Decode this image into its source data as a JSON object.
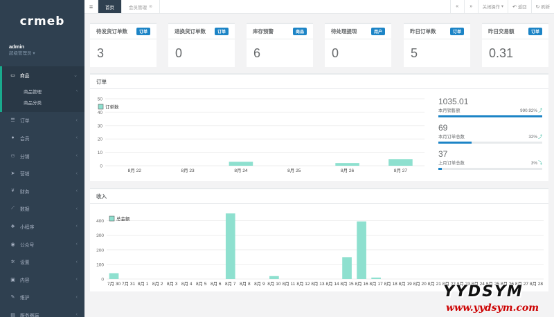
{
  "app": {
    "logo_text": "crmeb"
  },
  "profile": {
    "name": "admin",
    "role": "超级管理员"
  },
  "sidebar": {
    "items": [
      {
        "icon": "monitor-icon",
        "label": "商品",
        "active": true,
        "children": [
          {
            "label": "商品管理"
          },
          {
            "label": "商品分类"
          }
        ]
      },
      {
        "icon": "list-icon",
        "label": "订单"
      },
      {
        "icon": "user-icon",
        "label": "会员"
      },
      {
        "icon": "users-icon",
        "label": "分销"
      },
      {
        "icon": "send-icon",
        "label": "营销"
      },
      {
        "icon": "money-icon",
        "label": "财务"
      },
      {
        "icon": "chart-icon",
        "label": "数据"
      },
      {
        "icon": "cubes-icon",
        "label": "小程序"
      },
      {
        "icon": "wechat-icon",
        "label": "公众号"
      },
      {
        "icon": "gear-icon",
        "label": "设置"
      },
      {
        "icon": "box-icon",
        "label": "内容"
      },
      {
        "icon": "wrench-icon",
        "label": "维护"
      },
      {
        "icon": "server-icon",
        "label": "服务器端"
      }
    ]
  },
  "topbar": {
    "tabs": [
      {
        "label": "首页",
        "active": true
      },
      {
        "label": "会员管理",
        "active": false,
        "close": "⊗"
      }
    ],
    "close_ops": "关闭操作",
    "back": "返回",
    "refresh": "刷新"
  },
  "cards": [
    {
      "title": "待发货订单数",
      "badge": "订单",
      "value": "3"
    },
    {
      "title": "退换货订单数",
      "badge": "订单",
      "value": "0"
    },
    {
      "title": "库存预警",
      "badge": "商品",
      "value": "6"
    },
    {
      "title": "待处理提现",
      "badge": "用户",
      "value": "0"
    },
    {
      "title": "昨日订单数",
      "badge": "订单",
      "value": "5"
    },
    {
      "title": "昨日交易额",
      "badge": "订单",
      "value": "0.31"
    }
  ],
  "orders_panel": {
    "title": "订单",
    "stats": [
      {
        "value": "1035.01",
        "label": "本月销售额",
        "pct": "990.92%",
        "progress": 1.0
      },
      {
        "value": "69",
        "label": "本月订单总数",
        "pct": "32%",
        "progress": 0.32
      },
      {
        "value": "37",
        "label": "上月订单总数",
        "pct": "3%",
        "progress": 0.03
      }
    ]
  },
  "colors": {
    "bar": "#8ee0cf",
    "accent": "#1c84c6",
    "sidebar": "#2f4050",
    "active": "#19aa8d"
  },
  "chart_data": [
    {
      "type": "bar",
      "title": "订单",
      "series": [
        {
          "name": "订单数",
          "values": [
            0,
            0,
            3,
            0,
            2,
            5
          ]
        }
      ],
      "categories": [
        "8月 22",
        "8月 23",
        "8月 24",
        "8月 25",
        "8月 26",
        "8月 27"
      ],
      "ylim": [
        0,
        50
      ],
      "yticks": [
        0,
        10,
        20,
        30,
        40,
        50
      ],
      "legend": "top-left",
      "grid": true
    },
    {
      "type": "bar",
      "title": "收入",
      "series": [
        {
          "name": "总金额",
          "values": [
            40,
            0,
            0,
            0,
            0,
            0,
            0,
            0,
            450,
            0,
            0,
            20,
            0,
            0,
            0,
            0,
            150,
            395,
            10,
            0,
            0,
            0,
            0,
            0,
            0,
            0,
            0,
            0,
            0,
            0
          ]
        }
      ],
      "categories": [
        "7月 30",
        "7月 31",
        "8月 1",
        "8月 2",
        "8月 3",
        "8月 4",
        "8月 5",
        "8月 6",
        "8月 7",
        "8月 8",
        "8月 9",
        "8月 10",
        "8月 11",
        "8月 12",
        "8月 13",
        "8月 14",
        "8月 15",
        "8月 16",
        "8月 17",
        "8月 18",
        "8月 19",
        "8月 20",
        "8月 21",
        "8月 22",
        "8月 23",
        "8月 24",
        "8月 25",
        "8月 26",
        "8月 27",
        "8月 28"
      ],
      "ylim": [
        0,
        450
      ],
      "yticks": [
        0,
        100,
        200,
        300,
        400
      ],
      "legend": "top-left",
      "grid": true
    }
  ],
  "watermark": {
    "line1": "YYDSYM",
    "line2": "www.yydsym.com"
  }
}
